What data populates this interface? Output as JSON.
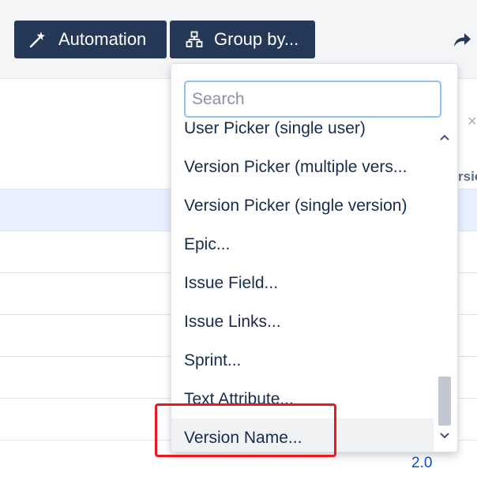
{
  "toolbar": {
    "automation_label": "Automation",
    "group_by_label": "Group by..."
  },
  "table": {
    "header_fragment": "rsio",
    "close_fragment": "×",
    "version_value": "2.0"
  },
  "dropdown": {
    "search_placeholder": "Search",
    "items": [
      "User Picker (single user)",
      "Version Picker (multiple vers...",
      "Version Picker (single version)",
      "Epic...",
      "Issue Field...",
      "Issue Links...",
      "Sprint...",
      "Text Attribute...",
      "Version Name..."
    ],
    "selected_item": "Version Name..."
  },
  "scrollbar": {
    "up_glyph": "⌃",
    "down_glyph": "⌄",
    "position": 0.82
  },
  "colors": {
    "button_bg": "#253858",
    "highlight_border": "#e8191f",
    "link": "#0052cc",
    "row_highlight": "#e9f0fd"
  },
  "icons": {
    "automation": "magic-wand-icon",
    "group_by": "hierarchy-icon",
    "share": "share-arrow-icon"
  }
}
